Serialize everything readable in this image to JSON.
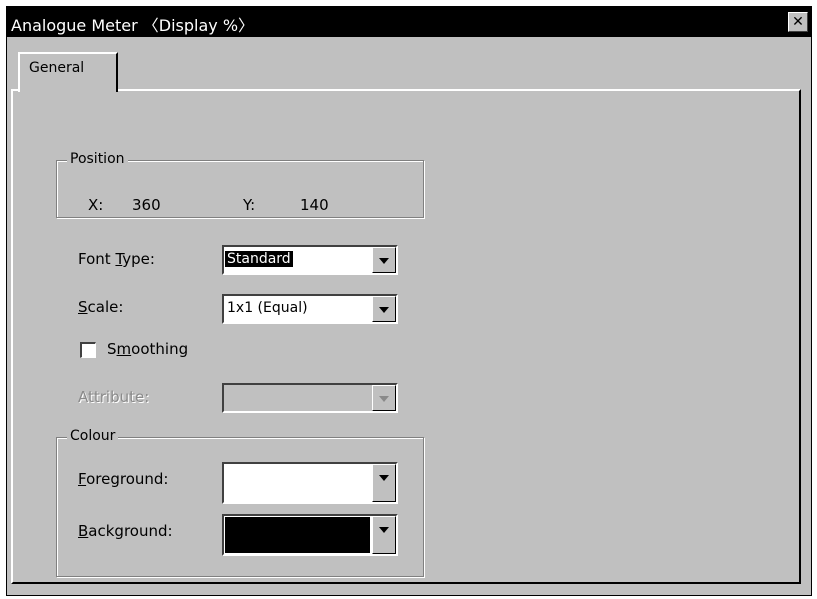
{
  "window": {
    "title": "Analogue Meter 〈Display %〉",
    "close_glyph": "✕"
  },
  "tabs": [
    {
      "label": "General",
      "active": true
    }
  ],
  "position_group": {
    "legend": "Position",
    "x_label": "X:",
    "x_value": "360",
    "y_label": "Y:",
    "y_value": "140"
  },
  "font_type": {
    "label_pre": "Font ",
    "label_mnemonic": "T",
    "label_post": "ype:",
    "value": "Standard"
  },
  "scale": {
    "label_mnemonic": "S",
    "label_post": "cale:",
    "value": "1x1 (Equal)"
  },
  "smoothing": {
    "label_pre": "S",
    "label_mnemonic": "m",
    "label_post": "oothing",
    "checked": false
  },
  "attribute": {
    "label": "Attribute:",
    "value": "",
    "enabled": false
  },
  "colour_group": {
    "legend": "Colour",
    "foreground": {
      "label_mnemonic": "F",
      "label_post": "oreground:",
      "color": "#ffffff"
    },
    "background": {
      "label_mnemonic": "B",
      "label_post": "ackground:",
      "color": "#000000"
    }
  },
  "colors": {
    "dialog_face": "#c0c0c0",
    "titlebar": "#000000",
    "disabled_text": "#8a8a8a"
  },
  "icons": {
    "close": "close-icon",
    "dropdown": "chevron-down-icon"
  }
}
